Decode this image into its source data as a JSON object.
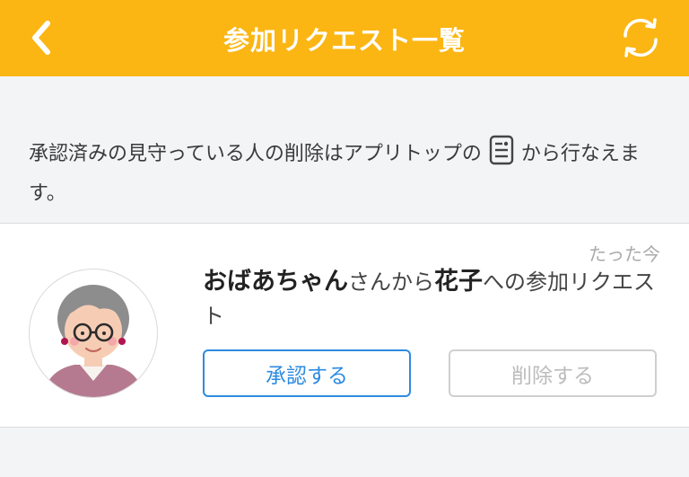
{
  "header": {
    "title": "参加リクエスト一覧",
    "background": "#fbb613",
    "back_icon": "chevron-left-icon",
    "refresh_icon": "refresh-icon"
  },
  "notice": {
    "text_before": "承認済みの見守っている人の削除はアプリトップの",
    "icon": "document-list-icon",
    "text_after": "から行なえます。"
  },
  "request": {
    "timestamp": "たった今",
    "requester": "おばあちゃん",
    "text_1": "さんから",
    "target": "花子",
    "text_2": "への参加リクエスト",
    "approve_label": "承認する",
    "delete_label": "削除する",
    "accent": "#2d8be0"
  }
}
